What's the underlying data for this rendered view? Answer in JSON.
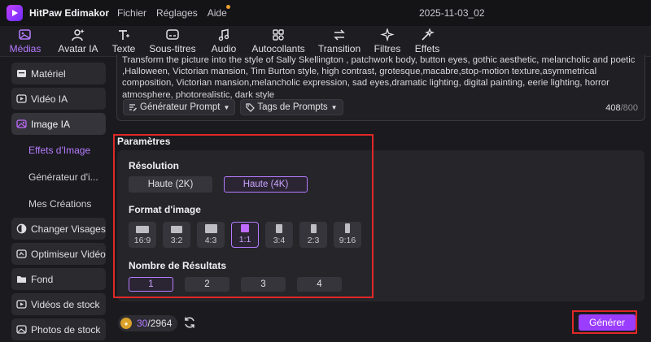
{
  "titlebar": {
    "app_name": "HitPaw Edimakor",
    "menu": [
      "Fichier",
      "Réglages",
      "Aide"
    ],
    "project_name": "2025-11-03_02"
  },
  "toolbar": {
    "tabs": [
      "Médias",
      "Avatar IA",
      "Texte",
      "Sous-titres",
      "Audio",
      "Autocollants",
      "Transition",
      "Filtres",
      "Effets"
    ],
    "active_tab": "Médias"
  },
  "sidebar": {
    "items": [
      {
        "label": "Matériel",
        "icon": "box-icon"
      },
      {
        "label": "Vidéo IA",
        "icon": "video-ai-icon"
      },
      {
        "label": "Image IA",
        "icon": "image-ai-icon"
      }
    ],
    "subitems": [
      "Effets d'Image",
      "Générateur d'i...",
      "Mes Créations"
    ],
    "active_subitem": "Effets d'Image",
    "items_bottom": [
      {
        "label": "Changer Visages",
        "icon": "face-swap-icon"
      },
      {
        "label": "Optimiseur Vidéo",
        "icon": "enhancer-icon"
      },
      {
        "label": "Fond",
        "icon": "folder-icon"
      },
      {
        "label": "Vidéos de stock",
        "icon": "stock-video-icon"
      },
      {
        "label": "Photos de stock",
        "icon": "stock-photo-icon"
      }
    ]
  },
  "prompt": {
    "text": "Transform the picture  into the style of Sally Skellington , patchwork body, button eyes, gothic aesthetic, melancholic and poetic ,Halloween, Victorian mansion, Tim Burton style, high contrast, grotesque,macabre,stop-motion texture,asymmetrical composition, Victorian mansion,melancholic expression, sad eyes,dramatic lighting, digital painting, eerie lighting, horror atmosphere, photorealistic, dark style",
    "generator_label": "Générateur Prompt",
    "tags_label": "Tags de Prompts",
    "char_count": "408",
    "char_max": "/800"
  },
  "params": {
    "title": "Paramètres",
    "resolution_label": "Résolution",
    "resolutions": [
      "Haute (2K)",
      "Haute (4K)"
    ],
    "selected_resolution": "Haute (4K)",
    "format_label": "Format d'image",
    "formats": [
      "16:9",
      "3:2",
      "4:3",
      "1:1",
      "3:4",
      "2:3",
      "9:16"
    ],
    "selected_format": "1:1",
    "results_label": "Nombre de Résultats",
    "results": [
      "1",
      "2",
      "3",
      "4"
    ],
    "selected_result": "1"
  },
  "footer": {
    "credits_used": "30",
    "credits_total": "/2964",
    "generate_label": "Générer"
  },
  "colors": {
    "accent": "#b57bff",
    "button": "#9b3dff",
    "highlight_box": "#e02828"
  }
}
